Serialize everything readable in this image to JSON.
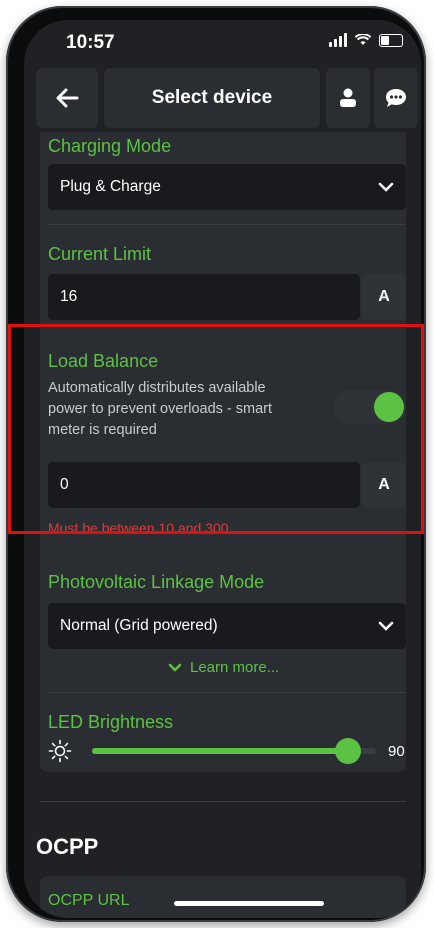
{
  "status_bar": {
    "time": "10:57"
  },
  "header": {
    "title": "Select device"
  },
  "charging_mode": {
    "label": "Charging Mode",
    "value": "Plug & Charge"
  },
  "current_limit": {
    "label": "Current Limit",
    "value": "16",
    "unit": "A"
  },
  "load_balance": {
    "label": "Load Balance",
    "description_line1": "Automatically distributes available",
    "description_line2": "power to prevent overloads - smart",
    "description_line3": "meter is required",
    "enabled": true,
    "value": "0",
    "unit": "A",
    "error": "Must be between 10 and 300"
  },
  "pv_linkage": {
    "label": "Photovoltaic Linkage Mode",
    "value": "Normal (Grid powered)",
    "learn_more": "Learn more..."
  },
  "led_brightness": {
    "label": "LED Brightness",
    "value": "90",
    "level_fraction": 0.9
  },
  "ocpp": {
    "title": "OCPP",
    "url_label": "OCPP URL"
  },
  "colors": {
    "accent": "#5cc243",
    "error": "#e23b3b",
    "highlight": "#e01010",
    "background": "#1f2124",
    "card": "#2a2d31"
  }
}
